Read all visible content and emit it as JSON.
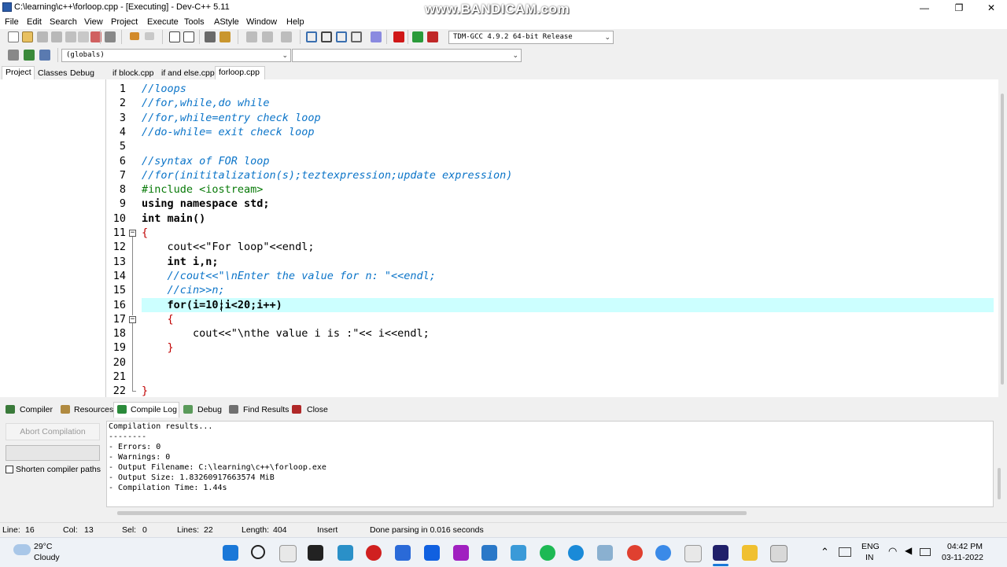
{
  "window": {
    "title": "C:\\learning\\c++\\forloop.cpp - [Executing] - Dev-C++ 5.11",
    "watermark": "www.BANDICAM.com",
    "minimize": "—",
    "maximize": "❐",
    "close": "✕"
  },
  "menu": [
    "File",
    "Edit",
    "Search",
    "View",
    "Project",
    "Execute",
    "Tools",
    "AStyle",
    "Window",
    "Help"
  ],
  "toolbar": {
    "compiler_select": "TDM-GCC 4.9.2 64-bit Release",
    "globals_select": "(globals)",
    "members_select": ""
  },
  "left_tabs": [
    "Project",
    "Classes",
    "Debug"
  ],
  "file_tabs": [
    "if block.cpp",
    "if and else.cpp",
    "forloop.cpp"
  ],
  "editor": {
    "line_numbers": [
      "1",
      "2",
      "3",
      "4",
      "5",
      "6",
      "7",
      "8",
      "9",
      "10",
      "11",
      "12",
      "13",
      "14",
      "15",
      "16",
      "17",
      "18",
      "19",
      "20",
      "21",
      "22"
    ],
    "code_lines": [
      "//loops",
      "//for,while,do while",
      "//for,while=entry check loop",
      "//do-while= exit check loop",
      "",
      "//syntax of FOR loop",
      "//for(inititalization(s);teztexpression;update expression)",
      "#include <iostream>",
      "using namespace std;",
      "int main()",
      "{",
      "    cout<<\"For loop\"<<endl;",
      "    int i,n;",
      "    //cout<<\"\\nEnter the value for n: \"<<endl;",
      "    //cin>>n;",
      "    for(i=10;i<20;i++)",
      "    {",
      "        cout<<\"\\nthe value i is :\"<< i<<endl;",
      "    }",
      "",
      "",
      "}"
    ],
    "highlighted_line": 16
  },
  "bottom_tabs": [
    "Compiler",
    "Resources",
    "Compile Log",
    "Debug",
    "Find Results",
    "Close"
  ],
  "bottom_left": {
    "abort_button": "Abort Compilation",
    "shorten_paths_label": "Shorten compiler paths"
  },
  "compile_log": [
    "Compilation results...",
    "--------",
    "- Errors: 0",
    "- Warnings: 0",
    "- Output Filename: C:\\learning\\c++\\forloop.exe",
    "- Output Size: 1.83260917663574 MiB",
    "- Compilation Time: 1.44s"
  ],
  "status": {
    "line_label": "Line:",
    "line_value": "16",
    "col_label": "Col:",
    "col_value": "13",
    "sel_label": "Sel:",
    "sel_value": "0",
    "lines_label": "Lines:",
    "lines_value": "22",
    "length_label": "Length:",
    "length_value": "404",
    "mode": "Insert",
    "message": "Done parsing in 0.016 seconds"
  },
  "taskbar": {
    "weather_temp": "29°C",
    "weather_desc": "Cloudy",
    "lang_top": "ENG",
    "lang_bottom": "IN",
    "time": "04:42 PM",
    "date": "03-11-2022"
  }
}
